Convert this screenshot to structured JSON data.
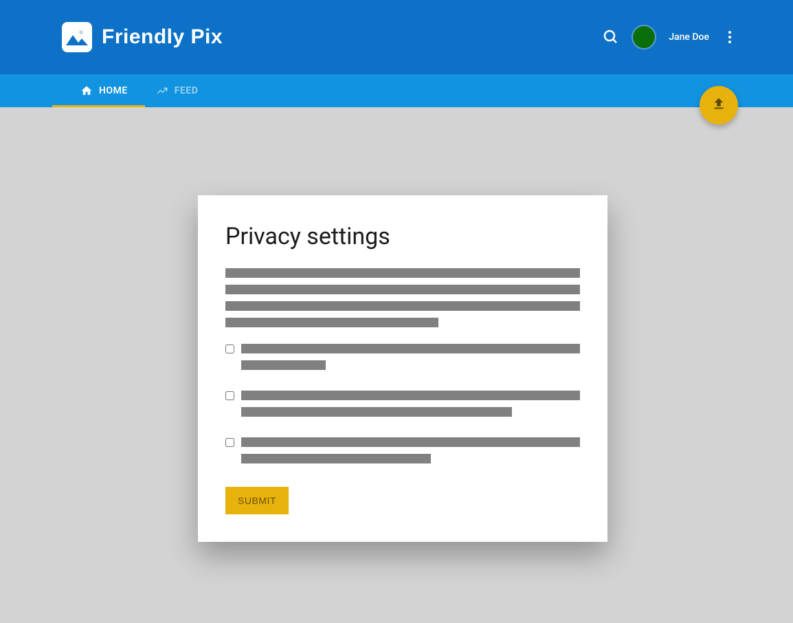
{
  "header": {
    "app_name": "Friendly Pix",
    "username": "Jane Doe"
  },
  "nav": {
    "tabs": [
      {
        "label": "HOME",
        "active": true
      },
      {
        "label": "FEED",
        "active": false
      }
    ]
  },
  "card": {
    "title": "Privacy settings",
    "submit_label": "SUBMIT"
  }
}
